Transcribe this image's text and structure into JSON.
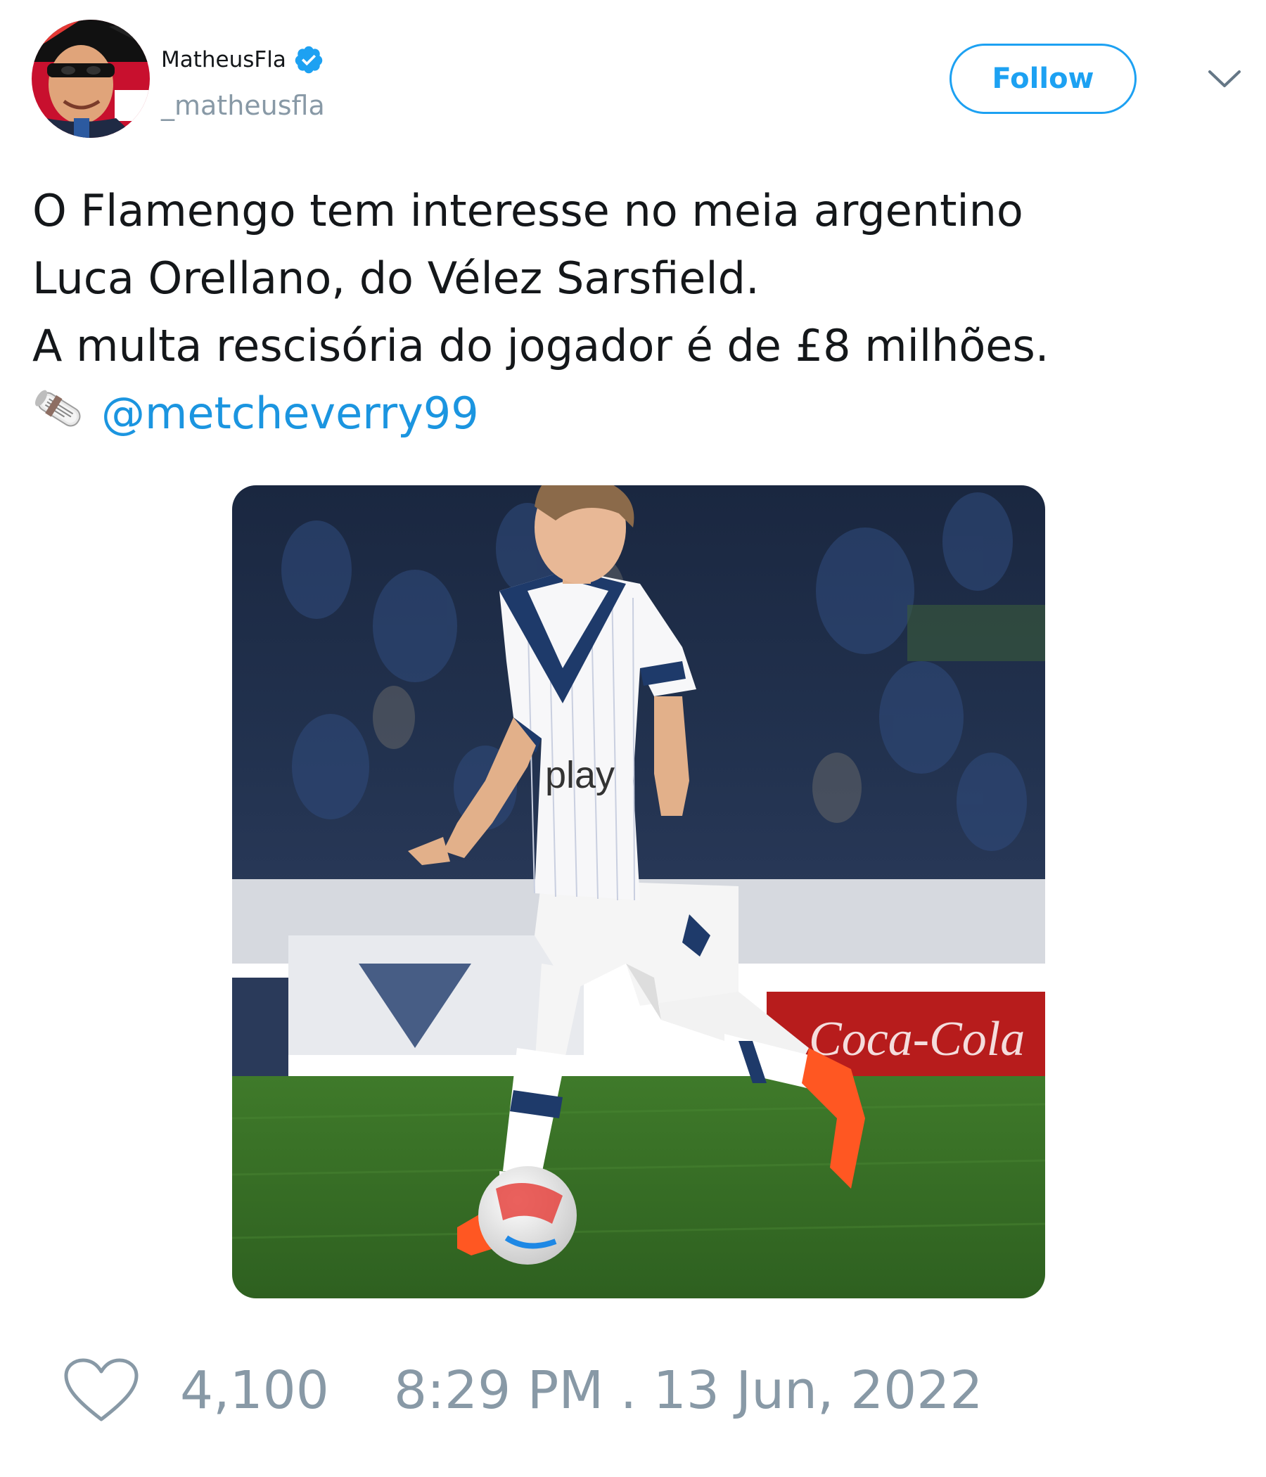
{
  "author": {
    "display_name": "MatheusFla",
    "handle": "_matheusfla",
    "verified": true,
    "avatar_icon": "avatar-photo"
  },
  "header": {
    "follow_label": "Follow",
    "menu_icon": "chevron-down-icon"
  },
  "tweet": {
    "lines": [
      "O Flamengo tem interesse no meia argentino",
      "Luca Orellano, do Vélez Sarsfield.",
      "A multa rescisória do jogador é de £8 milhões."
    ],
    "source_icon": "newspaper-icon",
    "mention": "@metcheverry99",
    "photo_icon": "football-player-photo"
  },
  "footer": {
    "like_icon": "heart-icon",
    "like_count": "4,100",
    "timestamp": "8:29 PM . 13 Jun, 2022"
  },
  "colors": {
    "accent": "#1da1f2",
    "mention": "#1b95e0",
    "muted": "#8899a6",
    "text": "#14171a"
  }
}
